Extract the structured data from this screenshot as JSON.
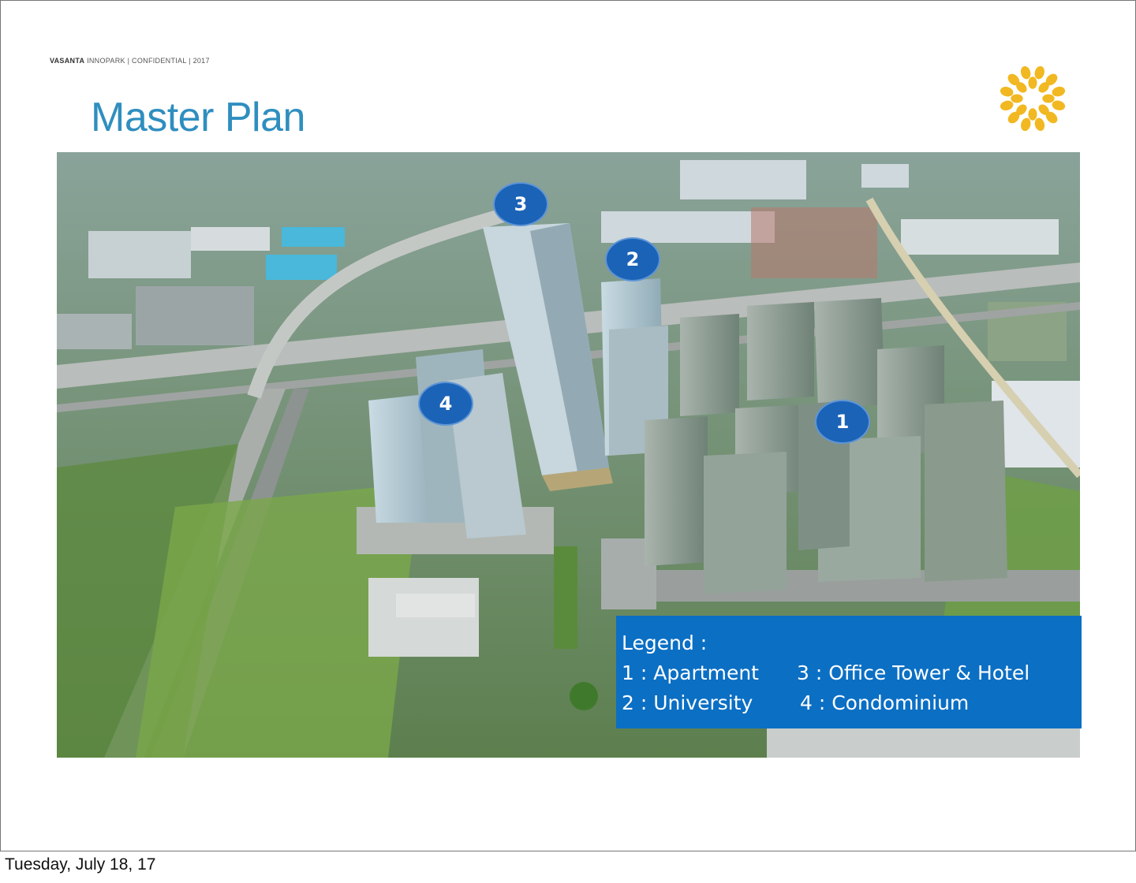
{
  "header": {
    "brand": "VASANTA",
    "tagline": "INNOPARK | CONFIDENTIAL | 2017"
  },
  "title": "Master Plan",
  "markers": [
    {
      "label": "3"
    },
    {
      "label": "2"
    },
    {
      "label": "4"
    },
    {
      "label": "1"
    }
  ],
  "legend": {
    "heading": "Legend :",
    "items": [
      {
        "text": "1 : Apartment"
      },
      {
        "text": "3 : Office Tower & Hotel"
      },
      {
        "text": "2 : University"
      },
      {
        "text": "4 : Condominium"
      }
    ]
  },
  "footer": {
    "date": "Tuesday, July 18, 17"
  },
  "colors": {
    "title": "#2f8ebf",
    "marker": "#1b63b6",
    "legend_bg": "#0b6fc4",
    "logo": "#f2b822"
  }
}
